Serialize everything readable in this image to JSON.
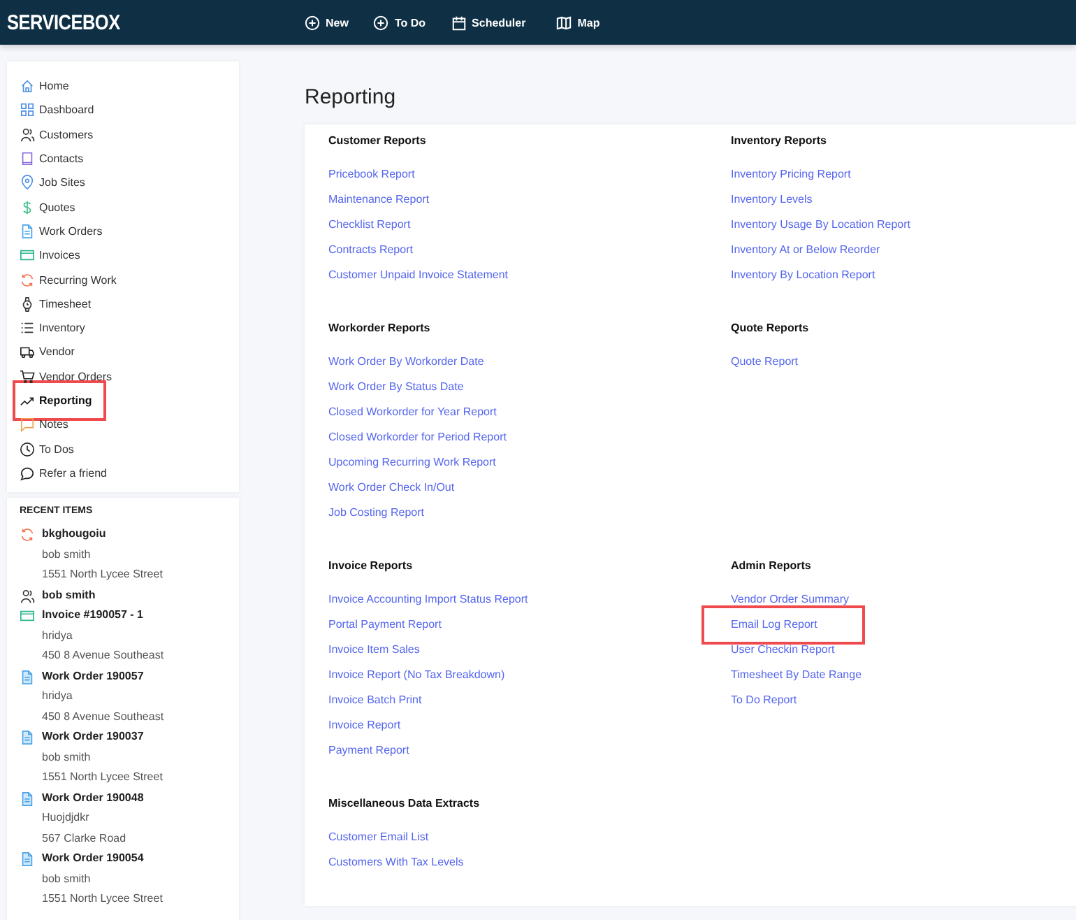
{
  "app": {
    "logo": "SERVICEBOX"
  },
  "topnav": [
    {
      "label": "New"
    },
    {
      "label": "To Do"
    },
    {
      "label": "Scheduler"
    },
    {
      "label": "Map"
    }
  ],
  "sidebar": {
    "items": [
      {
        "label": "Home",
        "selected": false,
        "highlighted": false
      },
      {
        "label": "Dashboard",
        "selected": false,
        "highlighted": false
      },
      {
        "label": "Customers",
        "selected": false,
        "highlighted": false
      },
      {
        "label": "Contacts",
        "selected": false,
        "highlighted": false
      },
      {
        "label": "Job Sites",
        "selected": false,
        "highlighted": false
      },
      {
        "label": "Quotes",
        "selected": false,
        "highlighted": false
      },
      {
        "label": "Work Orders",
        "selected": false,
        "highlighted": false
      },
      {
        "label": "Invoices",
        "selected": false,
        "highlighted": false
      },
      {
        "label": "Recurring Work",
        "selected": false,
        "highlighted": false
      },
      {
        "label": "Timesheet",
        "selected": false,
        "highlighted": false
      },
      {
        "label": "Inventory",
        "selected": false,
        "highlighted": false
      },
      {
        "label": "Vendor",
        "selected": false,
        "highlighted": false
      },
      {
        "label": "Vendor Orders",
        "selected": false,
        "highlighted": false
      },
      {
        "label": "Reporting",
        "selected": true,
        "highlighted": true
      },
      {
        "label": "Notes",
        "selected": false,
        "highlighted": false
      },
      {
        "label": "To Dos",
        "selected": false,
        "highlighted": false
      },
      {
        "label": "Refer a friend",
        "selected": false,
        "highlighted": false
      }
    ]
  },
  "recent": {
    "title": "RECENT ITEMS",
    "items": [
      {
        "kind": "recurring",
        "title": "bkghougoiu",
        "lines": [
          "bob smith",
          "1551 North Lycee Street"
        ]
      },
      {
        "kind": "customer",
        "title": "bob smith"
      },
      {
        "kind": "invoice",
        "title": "Invoice #190057 - 1",
        "lines": [
          "hridya",
          "450 8 Avenue Southeast"
        ]
      },
      {
        "kind": "work_order",
        "title": "Work Order 190057",
        "lines": [
          "hridya",
          "450 8 Avenue Southeast"
        ]
      },
      {
        "kind": "work_order",
        "title": "Work Order 190037",
        "lines": [
          "bob smith",
          "1551 North Lycee Street"
        ]
      },
      {
        "kind": "work_order",
        "title": "Work Order 190048",
        "lines": [
          "Huojdjdkr",
          "567 Clarke Road"
        ]
      },
      {
        "kind": "work_order",
        "title": "Work Order 190054",
        "lines": [
          "bob smith",
          "1551 North Lycee Street"
        ]
      }
    ]
  },
  "page": {
    "title": "Reporting"
  },
  "report_groups": [
    {
      "title": "Customer Reports",
      "links": [
        {
          "label": "Pricebook Report",
          "highlighted": false
        },
        {
          "label": "Maintenance Report",
          "highlighted": false
        },
        {
          "label": "Checklist Report",
          "highlighted": false
        },
        {
          "label": "Contracts Report",
          "highlighted": false
        },
        {
          "label": "Customer Unpaid Invoice Statement",
          "highlighted": false
        }
      ]
    },
    {
      "title": "Inventory Reports",
      "links": [
        {
          "label": "Inventory Pricing Report",
          "highlighted": false
        },
        {
          "label": "Inventory Levels",
          "highlighted": false
        },
        {
          "label": "Inventory Usage By Location Report",
          "highlighted": false
        },
        {
          "label": "Inventory At or Below Reorder",
          "highlighted": false
        },
        {
          "label": "Inventory By Location Report",
          "highlighted": false
        }
      ]
    },
    {
      "title": "Workorder Reports",
      "links": [
        {
          "label": "Work Order By Workorder Date",
          "highlighted": false
        },
        {
          "label": "Work Order By Status Date",
          "highlighted": false
        },
        {
          "label": "Closed Workorder for Year Report",
          "highlighted": false
        },
        {
          "label": "Closed Workorder for Period Report",
          "highlighted": false
        },
        {
          "label": "Upcoming Recurring Work Report",
          "highlighted": false
        },
        {
          "label": "Work Order Check In/Out",
          "highlighted": false
        },
        {
          "label": "Job Costing Report",
          "highlighted": false
        }
      ]
    },
    {
      "title": "Quote Reports",
      "links": [
        {
          "label": "Quote Report",
          "highlighted": false
        }
      ]
    },
    {
      "title": "Invoice Reports",
      "links": [
        {
          "label": "Invoice Accounting Import Status Report",
          "highlighted": false
        },
        {
          "label": "Portal Payment Report",
          "highlighted": false
        },
        {
          "label": "Invoice Item Sales",
          "highlighted": false
        },
        {
          "label": "Invoice Report (No Tax Breakdown)",
          "highlighted": false
        },
        {
          "label": "Invoice Batch Print",
          "highlighted": false
        },
        {
          "label": "Invoice Report",
          "highlighted": false
        },
        {
          "label": "Payment Report",
          "highlighted": false
        }
      ]
    },
    {
      "title": "Admin Reports",
      "links": [
        {
          "label": "Vendor Order Summary",
          "highlighted": false
        },
        {
          "label": "Email Log Report",
          "highlighted": true
        },
        {
          "label": "User Checkin Report",
          "highlighted": false
        },
        {
          "label": "Timesheet By Date Range",
          "highlighted": false
        },
        {
          "label": "To Do Report",
          "highlighted": false
        }
      ]
    },
    {
      "title": "Miscellaneous Data Extracts",
      "links": [
        {
          "label": "Customer Email List",
          "highlighted": false
        },
        {
          "label": "Customers With Tax Levels",
          "highlighted": false
        }
      ]
    }
  ]
}
